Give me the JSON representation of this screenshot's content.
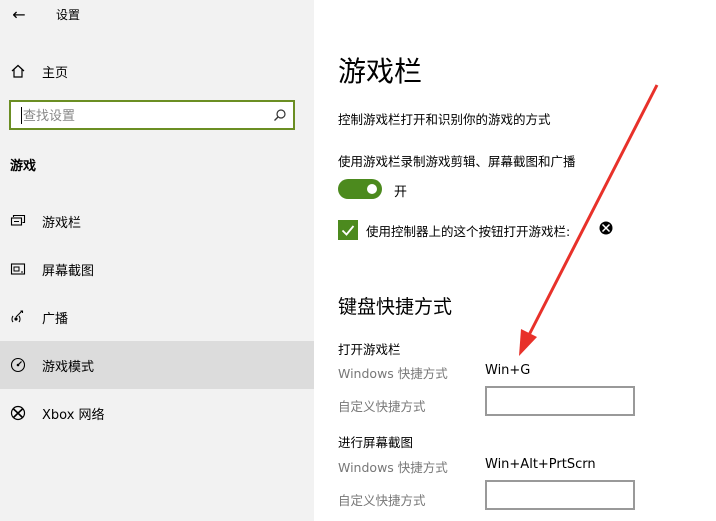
{
  "app": {
    "title": "设置",
    "back_label": "←"
  },
  "sidebar": {
    "home_label": "主页",
    "search_placeholder": "查找设置",
    "section_title": "游戏",
    "items": [
      {
        "label": "游戏栏",
        "icon": "gamebar-icon",
        "active": false
      },
      {
        "label": "屏幕截图",
        "icon": "screenshot-icon",
        "active": false
      },
      {
        "label": "广播",
        "icon": "broadcast-icon",
        "active": false
      },
      {
        "label": "游戏模式",
        "icon": "game-mode-icon",
        "active": true
      },
      {
        "label": "Xbox 网络",
        "icon": "xbox-icon",
        "active": false
      }
    ]
  },
  "main": {
    "title": "游戏栏",
    "subtitle": "控制游戏栏打开和识别你的游戏的方式",
    "record_toggle": {
      "label": "使用游戏栏录制游戏剪辑、屏幕截图和广播",
      "state": "开",
      "on": true
    },
    "controller_checkbox": {
      "label": "使用控制器上的这个按钮打开游戏栏:",
      "checked": true
    },
    "keyboard_section": "键盘快捷方式",
    "groups": [
      {
        "title": "打开游戏栏",
        "windows_label": "Windows 快捷方式",
        "windows_value": "Win+G",
        "custom_label": "自定义快捷方式",
        "custom_value": ""
      },
      {
        "title": "进行屏幕截图",
        "windows_label": "Windows 快捷方式",
        "windows_value": "Win+Alt+PrtScrn",
        "custom_label": "自定义快捷方式",
        "custom_value": ""
      }
    ]
  },
  "colors": {
    "accent": "#4c8a1e",
    "search_border": "#6b8e23",
    "arrow": "#e8312a",
    "sidebar_bg": "#f2f2f2"
  }
}
